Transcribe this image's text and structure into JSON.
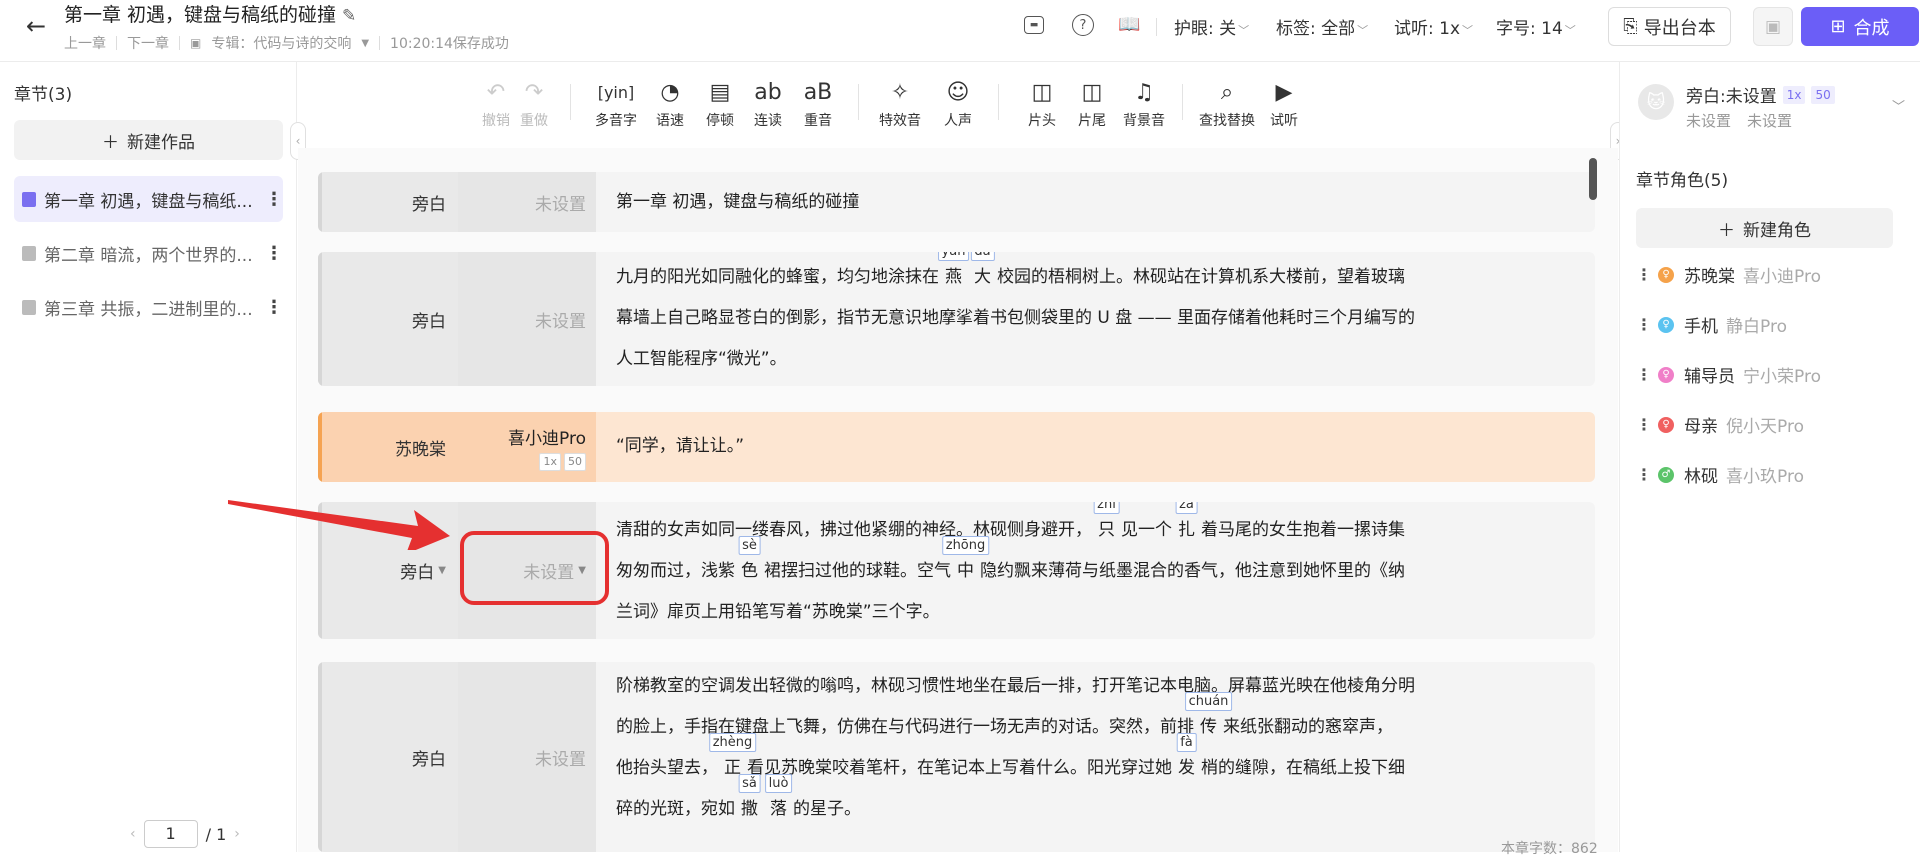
{
  "header": {
    "title": "第一章 初遇，键盘与稿纸的碰撞",
    "prev_chapter": "上一章",
    "next_chapter": "下一章",
    "album": "专辑：代码与诗的交响",
    "save_status": "10:20:14保存成功",
    "eye_protection": "护眼: 关",
    "tag_filter": "标签: 全部",
    "preview_speed": "试听: 1x",
    "font_size": "字号: 14",
    "export_label": "导出台本",
    "synthesize_label": "合成"
  },
  "left_panel": {
    "heading": "章节(3)",
    "new_work": "新建作品",
    "chapters": [
      {
        "label": "第一章 初遇，键盘与稿纸..."
      },
      {
        "label": "第二章 暗流，两个世界的..."
      },
      {
        "label": "第三章 共振，二进制里的..."
      }
    ],
    "pager": {
      "current": "1",
      "total": "/ 1"
    }
  },
  "toolbar": {
    "undo": "撤销",
    "redo": "重做",
    "polyphone": "多音字",
    "speed": "语速",
    "pause": "停顿",
    "liaison": "连读",
    "stress": "重音",
    "sfx": "特效音",
    "voice": "人声",
    "intro": "片头",
    "outro": "片尾",
    "bgm": "背景音",
    "find_replace": "查找替换",
    "preview": "试听"
  },
  "blocks": [
    {
      "role": "旁白",
      "voice": "未设置",
      "text": "第一章 初遇，键盘与稿纸的碰撞"
    },
    {
      "role": "旁白",
      "voice": "未设置",
      "p1": "九月的阳光如同融化的蜂蜜，均匀地涂抹在",
      "py1": {
        "char": "燕",
        "pin": "yān"
      },
      "py2": {
        "char": "大",
        "pin": "dà"
      },
      "p2": "校园的梧桐树上。林砚站在计算机系大楼前，望着玻璃",
      "p3": "幕墙上自己略显苍白的倒影，指节无意识地摩挲着书包侧袋里的 U 盘 —— 里面存储着他耗时三个月编写的",
      "p4": "人工智能程序“微光”。"
    },
    {
      "role": "苏晚棠",
      "voice": "喜小迪Pro",
      "speed_tag": "1x",
      "volume_tag": "50",
      "text": "“同学，请让让。”"
    },
    {
      "role": "旁白",
      "voice": "未设置",
      "p1": "清甜的女声如同一缕春风，拂过他紧绷的神经。林砚侧身避开，",
      "py1": {
        "char": "只",
        "pin": "zhī"
      },
      "p2": "见一个",
      "py2": {
        "char": "扎",
        "pin": "zā"
      },
      "p3": "着马尾的女生抱着一摞诗集",
      "p4": "匆匆而过，浅紫",
      "py3": {
        "char": "色",
        "pin": "sè"
      },
      "p5": "裙摆扫过他的球鞋。空气",
      "py4": {
        "char": "中",
        "pin": "zhōng"
      },
      "p6": "隐约飘来薄荷与纸墨混合的香气，他注意到她怀里的《纳",
      "p7": "兰词》扉页上用铅笔写着“苏晚棠”三个字。"
    },
    {
      "role": "旁白",
      "voice": "未设置",
      "p1": "阶梯教室的空调发出轻微的嗡鸣，林砚习惯性地坐在最后一排，打开笔记本电脑。屏幕蓝光映在他棱角分明",
      "p2": "的脸上，手指在键盘上飞舞，仿佛在与代码进行一场无声的对话。突然，前排",
      "py1": {
        "char": "传",
        "pin": "chuán"
      },
      "p3": "来纸张翻动的窸窣声，",
      "p4": "他抬头望去，",
      "py2": {
        "char": "正",
        "pin": "zhèng"
      },
      "p5": "看见苏晚棠咬着笔杆，在笔记本上写着什么。阳光穿过她",
      "py3": {
        "char": "发",
        "pin": "fà"
      },
      "p6": "梢的缝隙，在稿纸上投下细",
      "p7": "碎的光斑，宛如",
      "py4": {
        "char": "撒",
        "pin": "sǎ"
      },
      "py5": {
        "char": "落",
        "pin": "luò"
      },
      "p8": "的星子。"
    }
  ],
  "word_count": "本章字数：862",
  "right_panel": {
    "narrator_name": "旁白:未设置",
    "narrator_speed": "1x",
    "narrator_volume": "50",
    "narrator_sub1": "未设置",
    "narrator_sub2": "未设置",
    "roles_heading": "章节角色(5)",
    "new_role": "新建角色",
    "roles": [
      {
        "name": "苏晚棠",
        "voice": "喜小迪Pro",
        "color": "#f5a24a",
        "gender": "female"
      },
      {
        "name": "手机",
        "voice": "静白Pro",
        "color": "#5bc3f0",
        "gender": "female"
      },
      {
        "name": "辅导员",
        "voice": "宁小荣Pro",
        "color": "#f07fc8",
        "gender": "female"
      },
      {
        "name": "母亲",
        "voice": "倪小天Pro",
        "color": "#f06060",
        "gender": "female"
      },
      {
        "name": "林砚",
        "voice": "喜小玖Pro",
        "color": "#5cc46a",
        "gender": "male"
      }
    ]
  }
}
